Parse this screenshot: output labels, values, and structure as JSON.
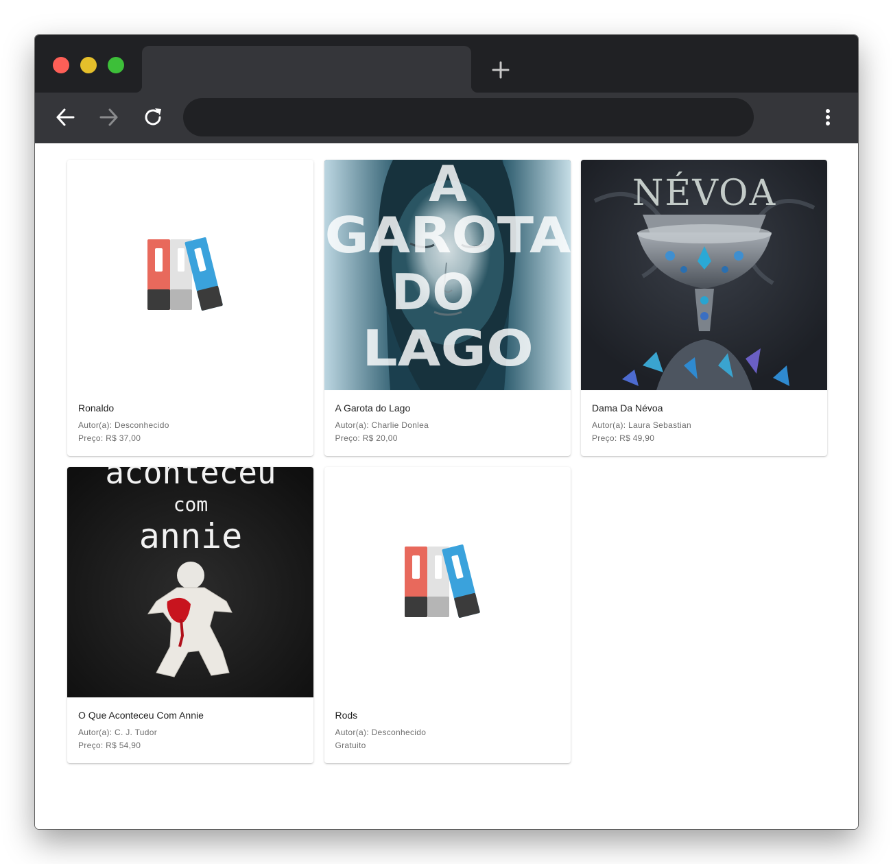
{
  "browser": {
    "tab_title": "",
    "address": ""
  },
  "books": [
    {
      "title": "Ronaldo",
      "author": "Autor(a): Desconhecido",
      "price": "Preço: R$ 37,00",
      "cover": "placeholder-books-icon"
    },
    {
      "title": "A Garota do Lago",
      "author": "Autor(a): Charlie Donlea",
      "price": "Preço: R$ 20,00",
      "cover": "cover-a-garota-do-lago",
      "cover_text": [
        "A",
        "GAROTA",
        "DO",
        "LAGO"
      ]
    },
    {
      "title": "Dama Da Névoa",
      "author": "Autor(a): Laura Sebastian",
      "price": "Preço: R$ 49,90",
      "cover": "cover-dama-da-nevoa",
      "cover_text": [
        "NÉVOA"
      ]
    },
    {
      "title": "O Que Aconteceu Com Annie",
      "author": "Autor(a): C. J. Tudor",
      "price": "Preço: R$ 54,90",
      "cover": "cover-o-que-aconteceu-com-annie",
      "cover_text": [
        "aconteceu",
        "com",
        "annie"
      ]
    },
    {
      "title": "Rods",
      "author": "Autor(a): Desconhecido",
      "price": "Gratuito",
      "cover": "placeholder-books-icon"
    }
  ],
  "colors": {
    "titlebar": "#202124",
    "toolbar": "#35363a",
    "book_red": "#e8695c",
    "book_gray": "#e2e2e2",
    "book_blue": "#3aa2dc",
    "book_dark": "#3b3b3b"
  }
}
